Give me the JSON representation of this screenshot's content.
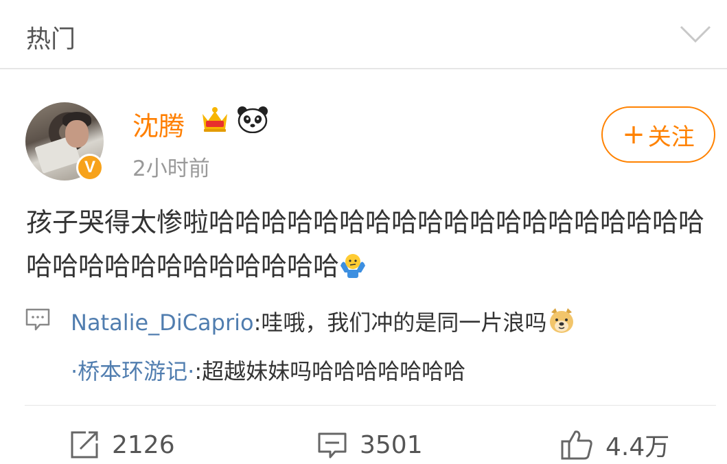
{
  "header": {
    "title": "热门",
    "chevron_icon": "chevron-down-icon"
  },
  "post": {
    "username": "沈腾",
    "badges": [
      "crown-icon",
      "panda-icon"
    ],
    "verified_mark": "V",
    "time": "2小时前",
    "follow_label": "关注",
    "body_text": "孩子哭得太惨啦哈哈哈哈哈哈哈哈哈哈哈哈哈哈哈哈哈哈哈哈哈哈哈哈哈哈哈哈哈哈哈",
    "body_emoji": "shrug-emoji-icon"
  },
  "comments": [
    {
      "user": "Natalie_DiCaprio",
      "separator": ":",
      "text": "哇哦，我们冲的是同一片浪吗",
      "emoji": "doge-emoji-icon"
    },
    {
      "user": "·桥本环游记·",
      "separator": ":",
      "text": "超越妹妹吗哈哈哈哈哈哈哈"
    }
  ],
  "actions": {
    "repost_count": "2126",
    "comment_count": "3501",
    "like_count": "4.4万"
  },
  "colors": {
    "accent": "#ff8200",
    "username": "#ff7f00",
    "link": "#507daf",
    "verified": "#f7a21b"
  }
}
